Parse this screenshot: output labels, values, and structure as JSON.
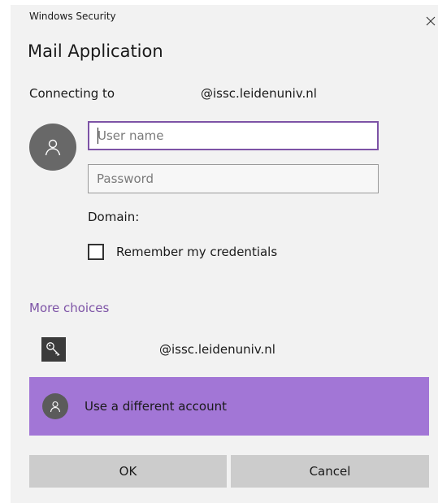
{
  "window": {
    "title": "Windows Security",
    "app_title": "Mail Application"
  },
  "connection": {
    "label": "Connecting to",
    "host": "@issc.leidenuniv.nl"
  },
  "form": {
    "username_placeholder": "User name",
    "password_placeholder": "Password",
    "domain_label": "Domain:",
    "remember_label": "Remember my credentials",
    "remember_checked": false
  },
  "more_choices": {
    "label": "More choices",
    "smartcard_host": "@issc.leidenuniv.nl",
    "different_account_label": "Use a different account"
  },
  "buttons": {
    "ok": "OK",
    "cancel": "Cancel"
  },
  "icons": {
    "close": "close-icon",
    "avatar": "user-icon",
    "key": "key-icon"
  },
  "colors": {
    "accent": "#7d53a6",
    "selected_row": "#a276d6",
    "dialog_bg": "#f2f2f2",
    "button_bg": "#cccccc"
  }
}
